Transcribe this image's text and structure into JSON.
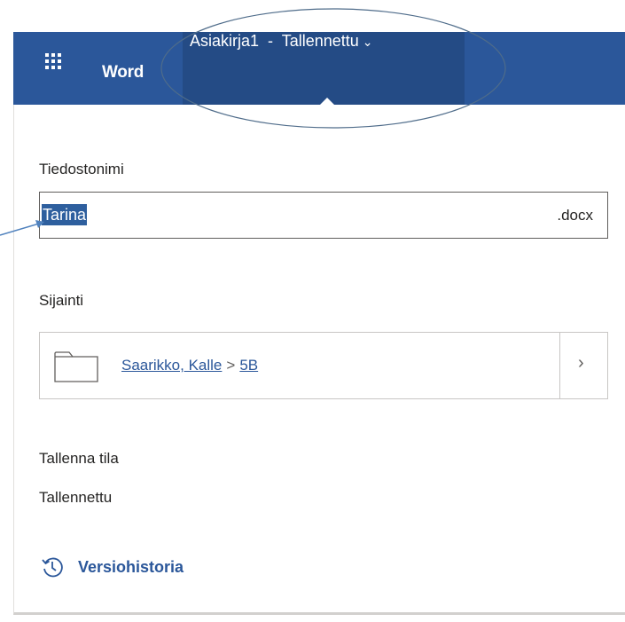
{
  "header": {
    "app_name": "Word",
    "doc_title": "Asiakirja1  -  Tallennettu",
    "chevron": "⌄"
  },
  "panel": {
    "filename_label": "Tiedostonimi",
    "filename_value": "Tarina",
    "extension": ".docx",
    "location_label": "Sijainti",
    "location_path": [
      "Saarikko, Kalle",
      "5B"
    ],
    "location_separator": ">",
    "location_chevron": "›",
    "save_state_label": "Tallenna tila",
    "save_state_value": "Tallennettu",
    "version_history_label": "Versiohistoria"
  },
  "colors": {
    "accent": "#2b579a",
    "annotation": "#4f81bd",
    "selection": "#2e5f9e"
  }
}
